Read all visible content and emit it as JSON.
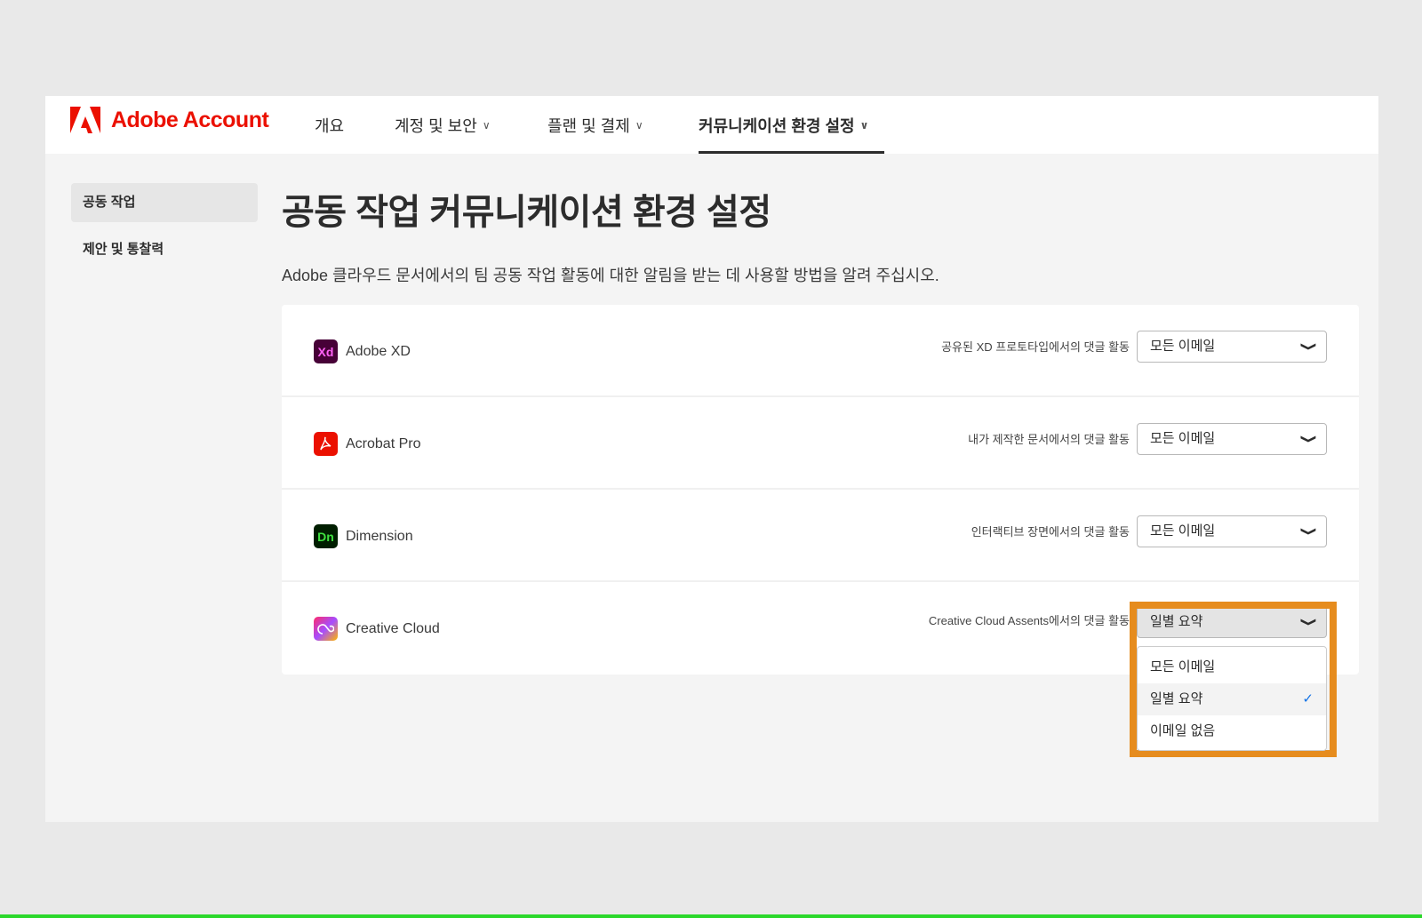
{
  "header": {
    "brand": "Adobe Account",
    "nav": [
      {
        "label": "개요",
        "chevron": false
      },
      {
        "label": "계정 및 보안",
        "chevron": true
      },
      {
        "label": "플랜 및 결제",
        "chevron": true
      },
      {
        "label": "커뮤니케이션 환경 설정",
        "chevron": true,
        "active": true
      }
    ]
  },
  "sidebar": {
    "items": [
      {
        "label": "공동 작업",
        "selected": true
      },
      {
        "label": "제안 및 통찰력"
      }
    ]
  },
  "main": {
    "title": "공동 작업 커뮤니케이션 환경 설정",
    "description": "Adobe 클라우드 문서에서의 팀 공동 작업 활동에 대한 알림을 받는 데 사용할 방법을 알려 주십시오.",
    "rows": [
      {
        "app": "Adobe XD",
        "icon_text": "Xd",
        "label": "공유된 XD 프로토타입에서의 댓글 활동",
        "value": "모든 이메일"
      },
      {
        "app": "Acrobat Pro",
        "label": "내가 제작한 문서에서의 댓글 활동",
        "value": "모든 이메일"
      },
      {
        "app": "Dimension",
        "icon_text": "Dn",
        "label": "인터랙티브 장면에서의 댓글 활동",
        "value": "모든 이메일"
      },
      {
        "app": "Creative Cloud",
        "label": "Creative Cloud Assents에서의 댓글 활동",
        "value": "일별 요약"
      }
    ],
    "dropdown_options": [
      "모든 이메일",
      "일별 요약",
      "이메일 없음"
    ],
    "selected_option": "일별 요약"
  },
  "colors": {
    "brand": "#eb1000",
    "highlight": "#e68c1e",
    "check": "#1473e6"
  }
}
